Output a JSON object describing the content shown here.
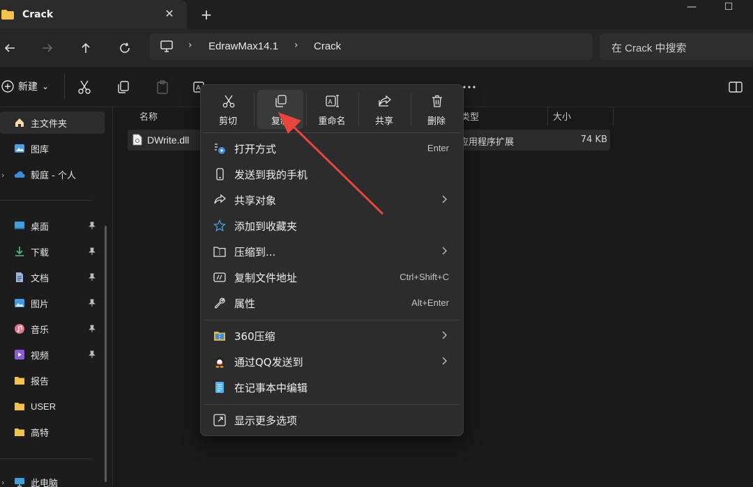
{
  "window": {
    "tab_title": "Crack",
    "tab_close": "✕",
    "new_tab": "+",
    "minimize": "—",
    "maximize": "☐"
  },
  "nav": {
    "breadcrumb": [
      "EdrawMax14.1",
      "Crack"
    ],
    "breadcrumb_sep": "›",
    "search_placeholder": "在 Crack 中搜索"
  },
  "toolbar": {
    "new_label": "新建",
    "new_caret": "⌄"
  },
  "sidebar": {
    "home": "主文件夹",
    "gallery": "图库",
    "onedrive": "毅庭 - 个人",
    "pinned": [
      {
        "label": "桌面",
        "icon": "desktop-icon"
      },
      {
        "label": "下载",
        "icon": "download-icon"
      },
      {
        "label": "文档",
        "icon": "document-icon"
      },
      {
        "label": "图片",
        "icon": "pictures-icon"
      },
      {
        "label": "音乐",
        "icon": "music-icon"
      },
      {
        "label": "视频",
        "icon": "video-icon"
      }
    ],
    "folders": [
      "报告",
      "USER",
      "高特"
    ],
    "this_pc": "此电脑"
  },
  "filelist": {
    "col_name": "名称",
    "col_type": "类型",
    "col_size": "大小",
    "file": {
      "name": "DWrite.dll",
      "type": "应用程序扩展",
      "size": "74 KB"
    }
  },
  "context_menu": {
    "quick_actions": [
      {
        "label": "剪切",
        "icon": "scissors-icon"
      },
      {
        "label": "复制",
        "icon": "copy-icon"
      },
      {
        "label": "重命名",
        "icon": "rename-icon"
      },
      {
        "label": "共享",
        "icon": "share-icon"
      },
      {
        "label": "删除",
        "icon": "trash-icon"
      }
    ],
    "items": [
      {
        "label": "打开方式",
        "shortcut": "Enter",
        "icon": "open-with-icon"
      },
      {
        "label": "发送到我的手机",
        "shortcut": "",
        "icon": "phone-icon"
      },
      {
        "label": "共享对象",
        "shortcut": "",
        "icon": "share-icon"
      },
      {
        "label": "添加到收藏夹",
        "shortcut": "",
        "icon": "star-icon"
      },
      {
        "label": "压缩到...",
        "shortcut": "",
        "icon": "zip-icon"
      },
      {
        "label": "复制文件地址",
        "shortcut": "Ctrl+Shift+C",
        "icon": "copy-path-icon"
      },
      {
        "label": "属性",
        "shortcut": "Alt+Enter",
        "icon": "wrench-icon"
      },
      {
        "label": "360压缩",
        "shortcut": "",
        "icon": "360zip-icon"
      },
      {
        "label": "通过QQ发送到",
        "shortcut": "",
        "icon": "qq-icon"
      },
      {
        "label": "在记事本中编辑",
        "shortcut": "",
        "icon": "notepad-icon"
      },
      {
        "label": "显示更多选项",
        "shortcut": "",
        "icon": "more-options-icon"
      }
    ]
  },
  "colors": {
    "accent_blue": "#4ca0e0",
    "annotation_red": "#e8453c"
  }
}
